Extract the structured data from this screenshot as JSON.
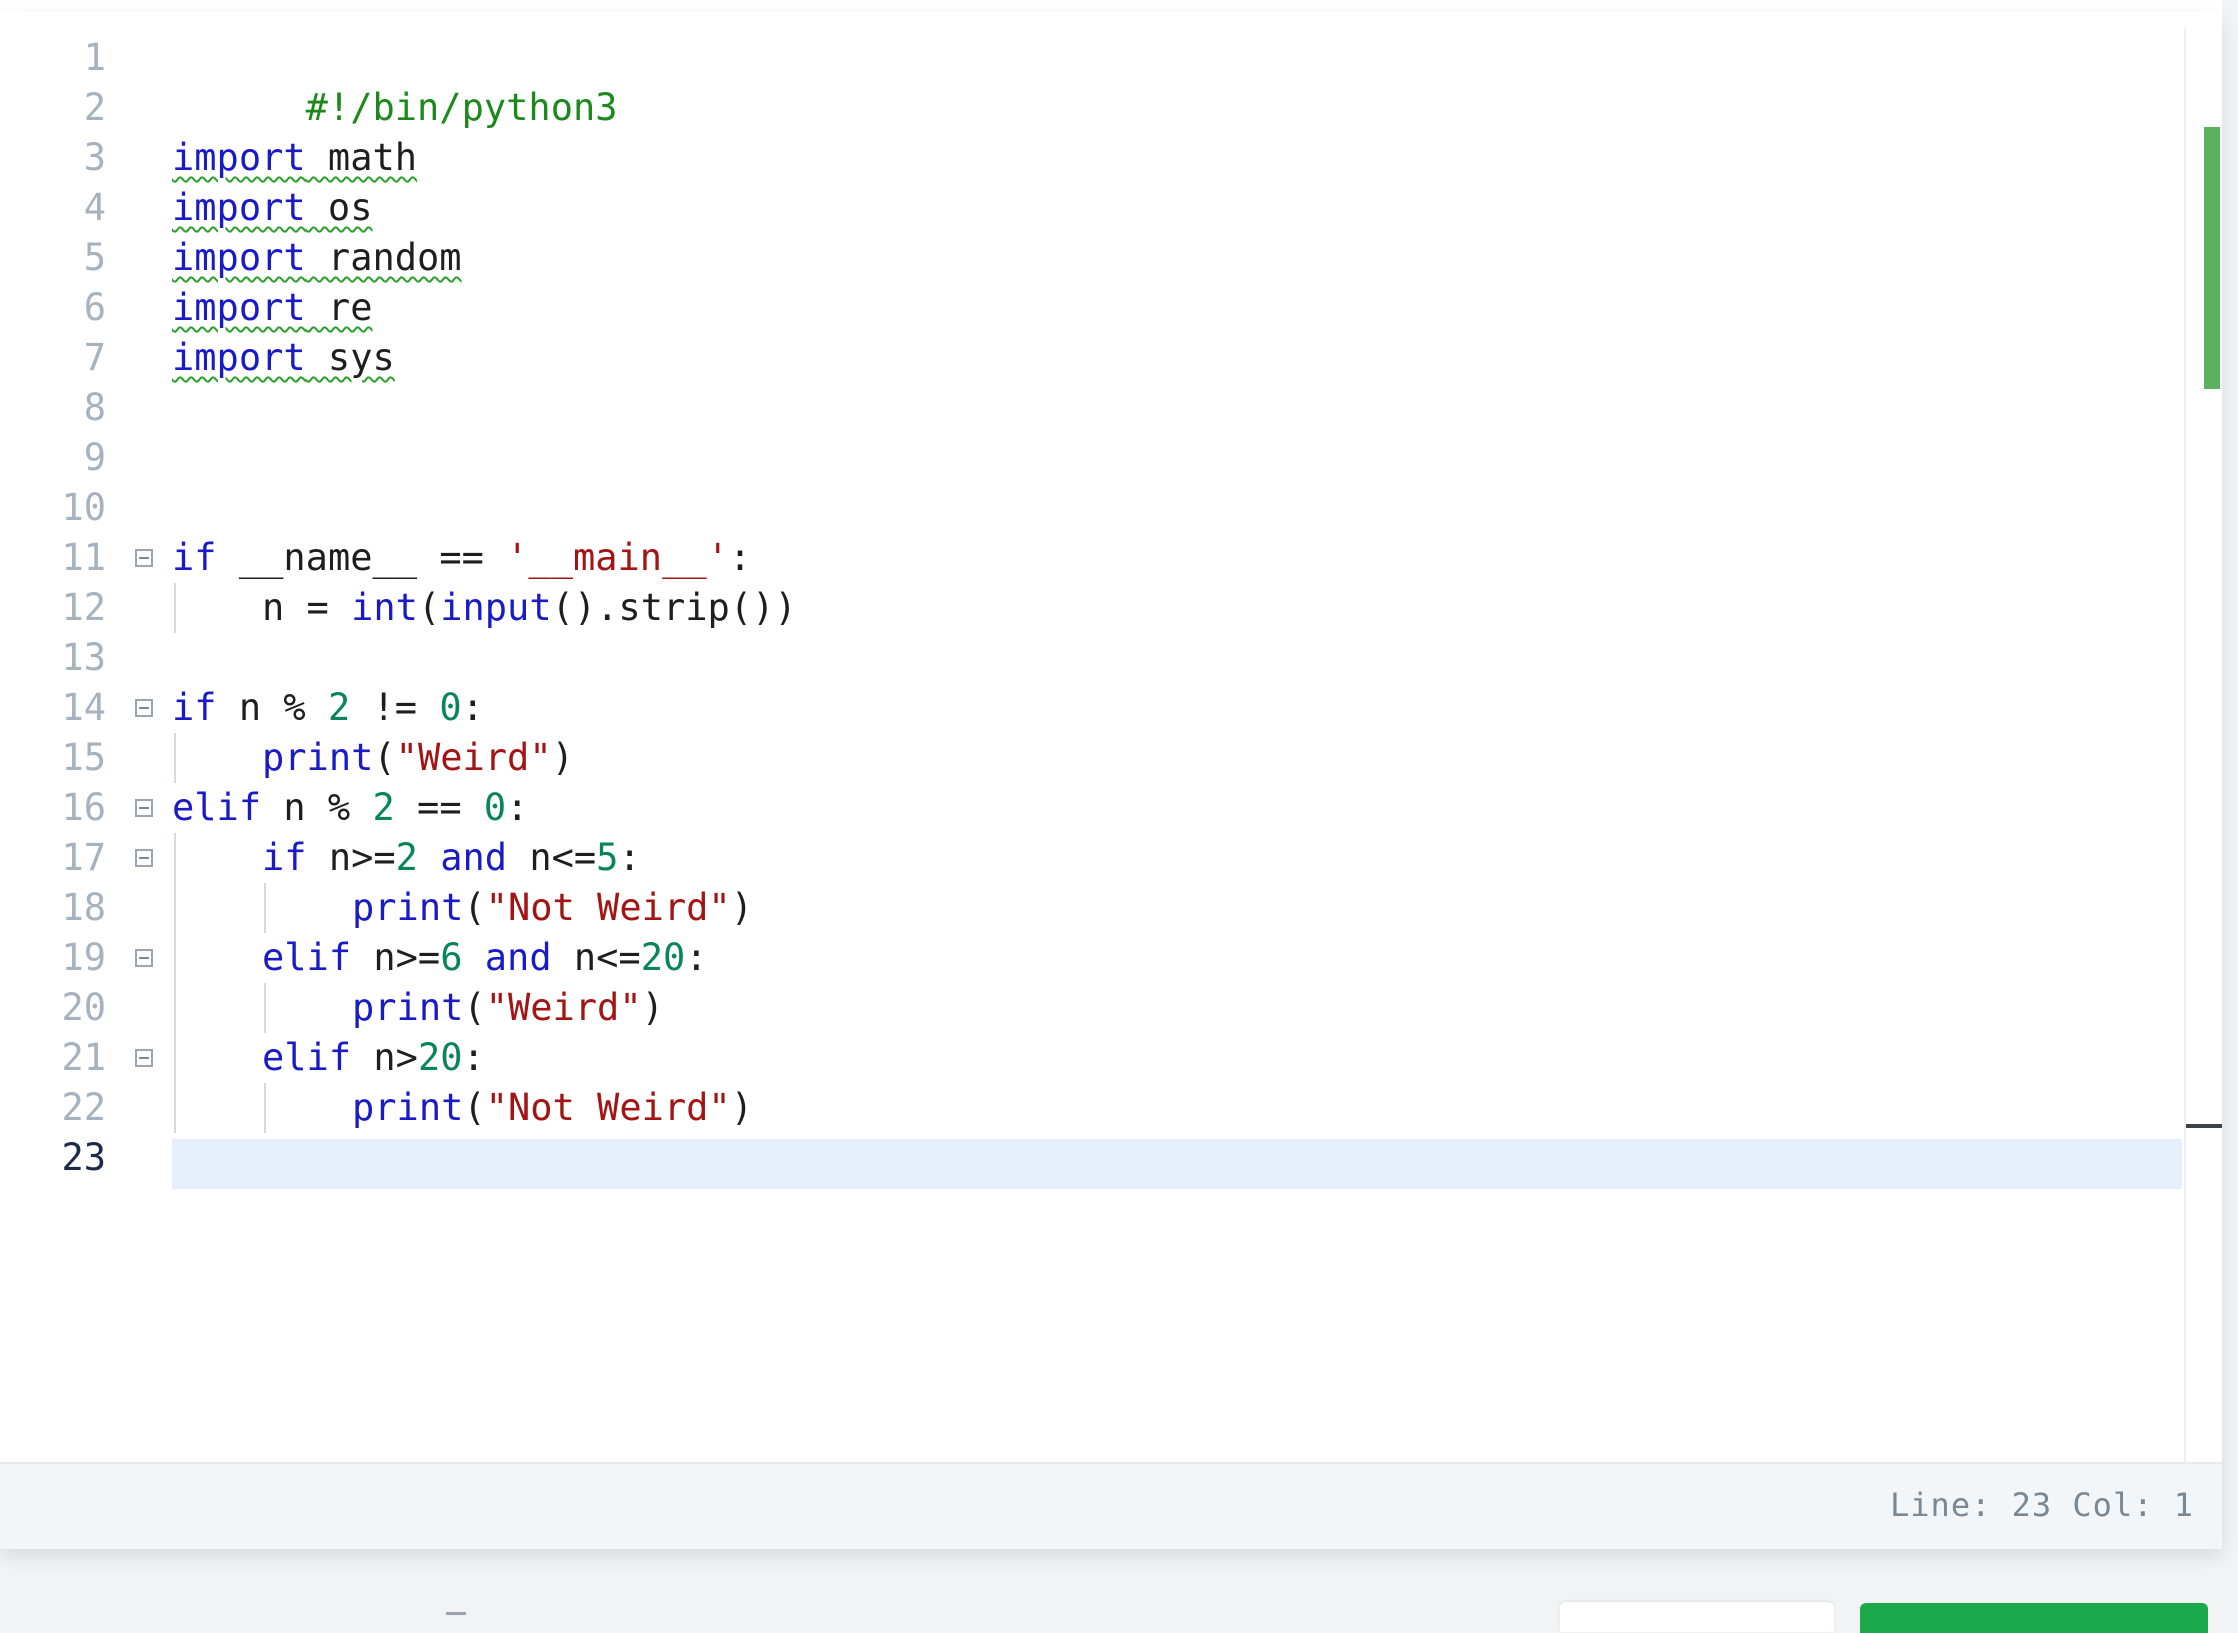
{
  "editor": {
    "colors": {
      "keyword": "#1a1ac7",
      "string": "#a31515",
      "number": "#098658",
      "comment": "#1b8a1b",
      "current_line": "#e8effc",
      "scroll_thumb": "#5cb15c",
      "primary_button": "#1ba94c"
    },
    "line_numbers": [
      "1",
      "2",
      "3",
      "4",
      "5",
      "6",
      "7",
      "8",
      "9",
      "10",
      "11",
      "12",
      "13",
      "14",
      "15",
      "16",
      "17",
      "18",
      "19",
      "20",
      "21",
      "22",
      "23"
    ],
    "active_line": "23",
    "code": {
      "l1": "#!/bin/python3",
      "import_kw": "import",
      "l3_mod": " math",
      "l4_mod": " os",
      "l5_mod": " random",
      "l6_mod": " re",
      "l7_mod": " sys",
      "if_kw": "if",
      "elif_kw": "elif",
      "and_kw": "and",
      "l11_a": " __name__ == ",
      "l11_str": "'__main__'",
      "l11_end": ":",
      "l12_a": "n = ",
      "l12_int": "int",
      "l12_b": "(",
      "l12_input": "input",
      "l12_c": "().strip())",
      "l14_a": " n % ",
      "l14_n2": "2",
      "l14_b": " != ",
      "l14_n0": "0",
      "colon": ":",
      "print_kw": "print",
      "open_paren": "(",
      "close_paren": ")",
      "str_weird": "\"Weird\"",
      "str_not_weird": "\"Not Weird\"",
      "l16_a": " n % ",
      "l16_n2": "2",
      "l16_b": " == ",
      "l16_n0": "0",
      "l17_a": " n>=",
      "l17_n2": "2",
      "l17_b": " n<=",
      "l17_n5": "5",
      "l19_a": " n>=",
      "l19_n6": "6",
      "l19_b": " n<=",
      "l19_n20": "20",
      "l21_a": " n>",
      "l21_n20": "20"
    },
    "status": "Line: 23 Col: 1"
  }
}
